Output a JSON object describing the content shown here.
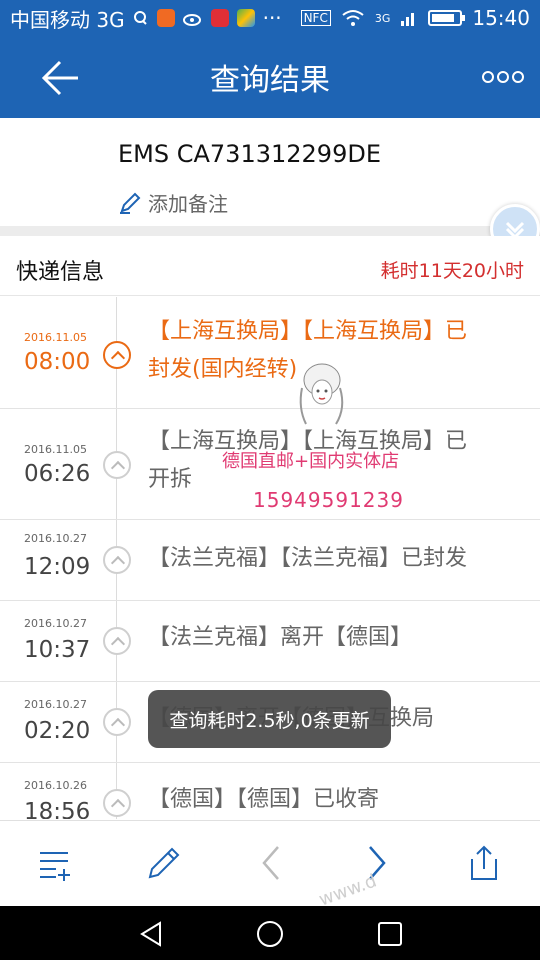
{
  "status_bar": {
    "carrier": "中国移动 3G",
    "time": "15:40",
    "nfc": "NFC",
    "network": "3G"
  },
  "app_bar": {
    "title": "查询结果"
  },
  "tracking": {
    "number": "EMS CA731312299DE",
    "add_note": "添加备注"
  },
  "info": {
    "label": "快递信息",
    "duration": "耗时11天20小时"
  },
  "entries": [
    {
      "date": "2016.11.05",
      "time": "08:00",
      "line1": "【上海互换局】【上海互换局】已",
      "line2": "封发(国内经转)",
      "active": true
    },
    {
      "date": "2016.11.05",
      "time": "06:26",
      "line1": "【上海互换局】【上海互换局】已",
      "line2": "开拆",
      "active": false
    },
    {
      "date": "2016.10.27",
      "time": "12:09",
      "line1": "【法兰克福】【法兰克福】已封发",
      "line2": "",
      "active": false
    },
    {
      "date": "2016.10.27",
      "time": "10:37",
      "line1": "【法兰克福】离开【德国】",
      "line2": "",
      "active": false
    },
    {
      "date": "2016.10.27",
      "time": "02:20",
      "line1": "【德国】离开【德国】互换局",
      "line2": "",
      "active": false
    },
    {
      "date": "2016.10.26",
      "time": "18:56",
      "line1": "【德国】【德国】已收寄",
      "line2": "",
      "active": false
    }
  ],
  "toast": "查询耗时2.5秒,0条更新",
  "overlay": {
    "shop_name": "德国直邮+国内实体店",
    "phone": "15949591239"
  },
  "watermark": "www.d",
  "colors": {
    "brand_blue": "#1e64b4",
    "accent_orange": "#ea6a14",
    "alert_red": "#d32f2f",
    "overlay_pink": "#e03a72"
  }
}
